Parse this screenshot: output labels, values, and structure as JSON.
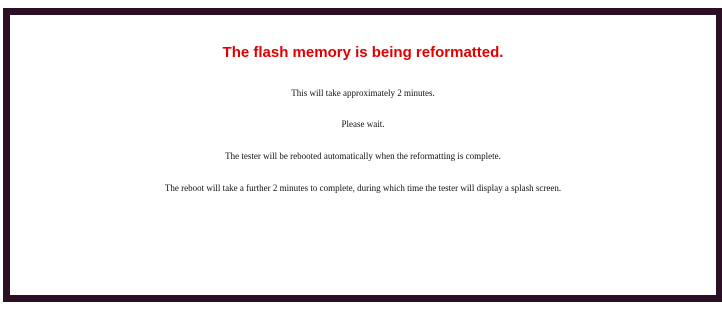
{
  "notice": {
    "title": "The flash memory is being reformatted.",
    "messages": [
      "This will take approximately 2 minutes.",
      "Please wait.",
      "The tester will be rebooted automatically when the reformatting is complete.",
      "The reboot will take a further 2 minutes to complete, during which time the tester will display a splash screen."
    ]
  },
  "colors": {
    "title": "#e00000",
    "frame_border": "#2b0f24",
    "background": "#ffffff"
  }
}
